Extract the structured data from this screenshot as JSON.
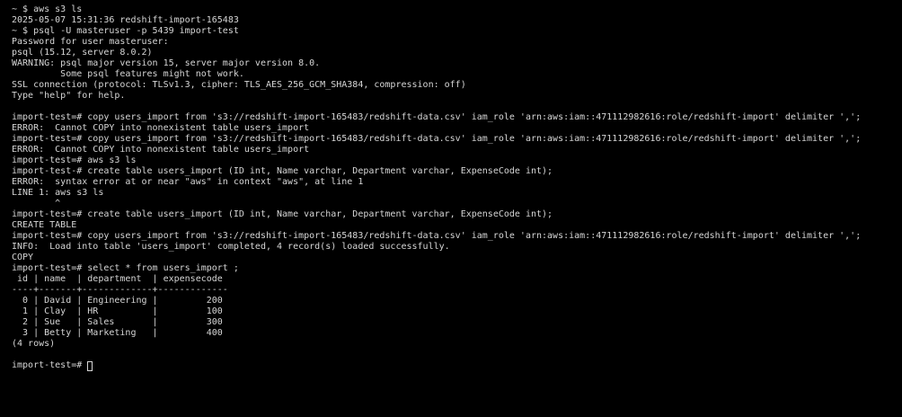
{
  "terminal": {
    "lines": [
      "~ $ aws s3 ls",
      "2025-05-07 15:31:36 redshift-import-165483",
      "~ $ psql -U masteruser -p 5439 import-test",
      "Password for user masteruser:",
      "psql (15.12, server 8.0.2)",
      "WARNING: psql major version 15, server major version 8.0.",
      "         Some psql features might not work.",
      "SSL connection (protocol: TLSv1.3, cipher: TLS_AES_256_GCM_SHA384, compression: off)",
      "Type \"help\" for help.",
      "",
      "import-test=# copy users_import from 's3://redshift-import-165483/redshift-data.csv' iam_role 'arn:aws:iam::471112982616:role/redshift-import' delimiter ',';",
      "ERROR:  Cannot COPY into nonexistent table users_import",
      "import-test=# copy users_import from 's3://redshift-import-165483/redshift-data.csv' iam_role 'arn:aws:iam::471112982616:role/redshift-import' delimiter ',';",
      "ERROR:  Cannot COPY into nonexistent table users_import",
      "import-test=# aws s3 ls",
      "import-test-# create table users_import (ID int, Name varchar, Department varchar, ExpenseCode int);",
      "ERROR:  syntax error at or near \"aws\" in context \"aws\", at line 1",
      "LINE 1: aws s3 ls",
      "        ^",
      "import-test=# create table users_import (ID int, Name varchar, Department varchar, ExpenseCode int);",
      "CREATE TABLE",
      "import-test=# copy users_import from 's3://redshift-import-165483/redshift-data.csv' iam_role 'arn:aws:iam::471112982616:role/redshift-import' delimiter ',';",
      "INFO:  Load into table 'users_import' completed, 4 record(s) loaded successfully.",
      "COPY",
      "import-test=# select * from users_import ;",
      " id | name  | department  | expensecode",
      "----+-------+-------------+-------------",
      "  0 | David | Engineering |         200",
      "  1 | Clay  | HR          |         100",
      "  2 | Sue   | Sales       |         300",
      "  3 | Betty | Marketing   |         400",
      "(4 rows)",
      ""
    ],
    "prompt": "import-test=# "
  }
}
